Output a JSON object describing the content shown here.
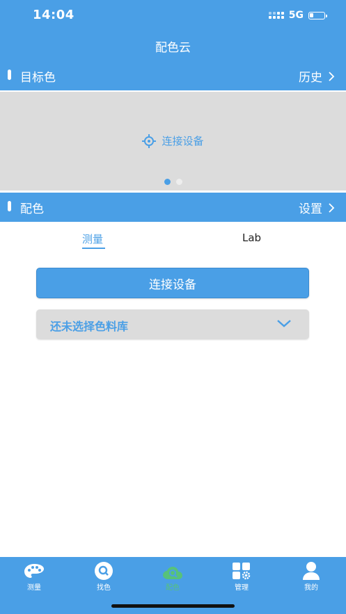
{
  "status_bar": {
    "time": "14:04",
    "network": "5G"
  },
  "app_title": "配色云",
  "target_section": {
    "title": "目标色",
    "link": "历史"
  },
  "carousel": {
    "connect_label": "连接设备",
    "page_count": 2,
    "active_page": 1
  },
  "match_section": {
    "title": "配色",
    "link": "设置"
  },
  "tabs": [
    {
      "label": "测量",
      "active": true
    },
    {
      "label": "Lab",
      "active": false
    }
  ],
  "connect_button": "连接设备",
  "library_select": {
    "value": "还未选择色料库"
  },
  "bottom_nav": [
    {
      "label": "测量",
      "icon": "palette-icon",
      "active": false
    },
    {
      "label": "找色",
      "icon": "search-icon",
      "active": false
    },
    {
      "label": "配色",
      "icon": "cloud-search-icon",
      "active": true
    },
    {
      "label": "管理",
      "icon": "grid-gear-icon",
      "active": false
    },
    {
      "label": "我的",
      "icon": "person-icon",
      "active": false
    }
  ],
  "colors": {
    "primary": "#4a9fe6",
    "active_tab": "#57c27a",
    "panel_gray": "#dcdcdc"
  }
}
